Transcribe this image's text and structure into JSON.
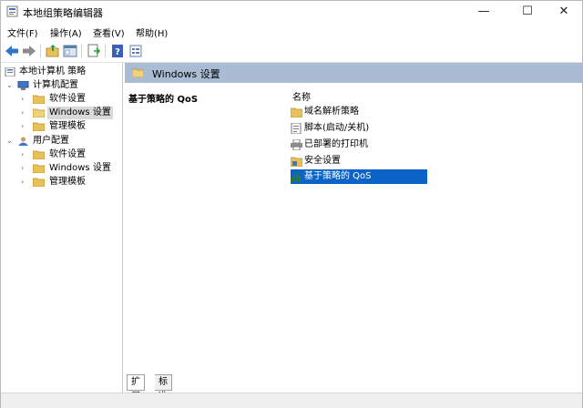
{
  "window": {
    "title": "本地组策略编辑器",
    "minimize": "—",
    "maximize": "☐",
    "close": "✕"
  },
  "menu": [
    {
      "label": "文件(F)"
    },
    {
      "label": "操作(A)"
    },
    {
      "label": "查看(V)"
    },
    {
      "label": "帮助(H)"
    }
  ],
  "toolbar": {
    "icons": [
      "back-arrow-icon",
      "forward-arrow-icon",
      "up-folder-icon",
      "show-hide-tree-icon",
      "export-list-icon",
      "help-icon",
      "properties-icon"
    ]
  },
  "tree": {
    "root": "本地计算机 策略",
    "computer_config": "计算机配置",
    "computer_children": [
      "软件设置",
      "Windows 设置",
      "管理模板"
    ],
    "user_config": "用户配置",
    "user_children": [
      "软件设置",
      "Windows 设置",
      "管理模板"
    ]
  },
  "main": {
    "header_title": "Windows 设置",
    "description_title": "基于策略的 QoS",
    "column_name": "名称",
    "items": [
      {
        "label": "域名解析策略",
        "icon": "folder-icon"
      },
      {
        "label": "脚本(启动/关机)",
        "icon": "script-icon"
      },
      {
        "label": "已部署的打印机",
        "icon": "printer-icon"
      },
      {
        "label": "安全设置",
        "icon": "security-settings-icon"
      },
      {
        "label": "基于策略的 QoS",
        "icon": "qos-chart-icon",
        "selected": true
      }
    ]
  },
  "tabs": [
    {
      "label": "扩展"
    },
    {
      "label": "标准"
    }
  ],
  "colors": {
    "header_strip": "#a9bcd3",
    "selection": "#0a64c8",
    "folder": "#e8c15a"
  }
}
